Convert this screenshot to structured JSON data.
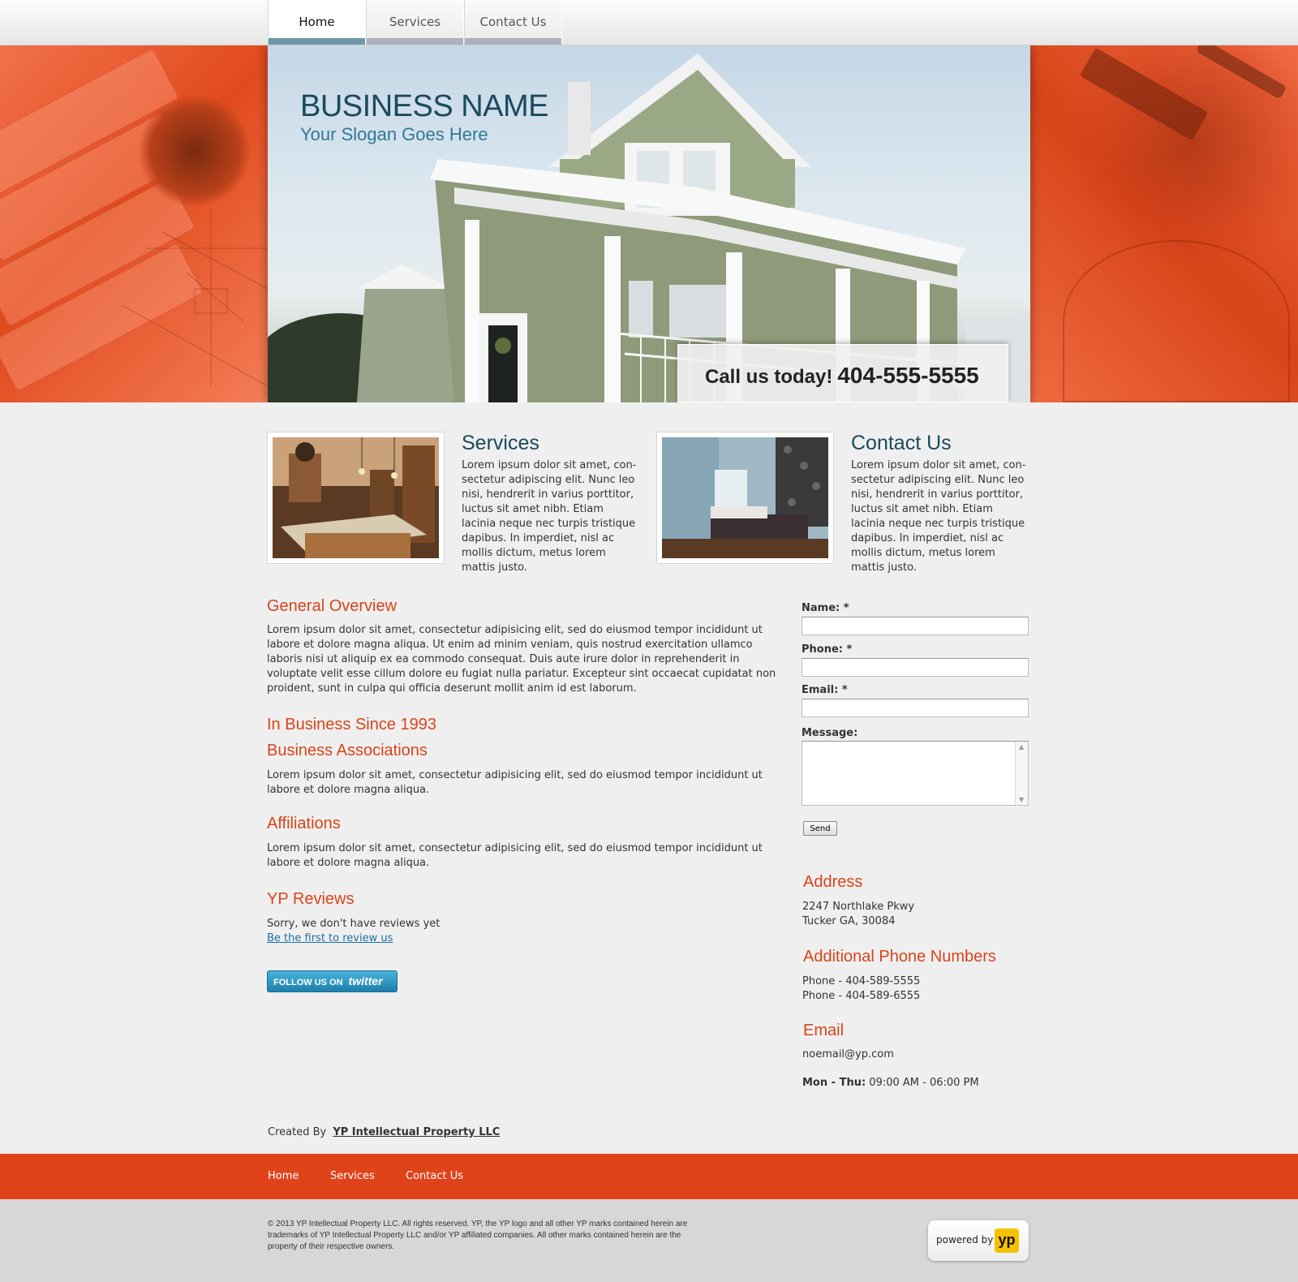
{
  "nav": {
    "items": [
      {
        "label": "Home",
        "active": true
      },
      {
        "label": "Services",
        "active": false
      },
      {
        "label": "Contact Us",
        "active": false
      }
    ]
  },
  "hero": {
    "business_name": "BUSINESS NAME",
    "slogan": "Your Slogan Goes Here",
    "call_label": "Call us today!",
    "phone": "404-555-5555"
  },
  "features": [
    {
      "title": "Services",
      "text": "Lorem ipsum dolor sit amet, con- sectetur adipiscing elit. Nunc leo nisi, hendrerit in varius porttitor, luctus sit amet nibh. Etiam lacinia neque nec turpis tristique dapibus. In imperdiet, nisl ac mollis dictum, metus lorem mattis justo."
    },
    {
      "title": "Contact Us",
      "text": "Lorem ipsum dolor sit amet, con- sectetur adipiscing elit. Nunc leo nisi, hendrerit in varius porttitor, luctus sit amet nibh. Etiam lacinia neque nec turpis tristique dapibus. In imperdiet, nisl ac mollis dictum, metus lorem mattis justo."
    }
  ],
  "main": {
    "overview_title": "General Overview",
    "overview_text": "Lorem ipsum dolor sit amet, consectetur adipisicing elit, sed do eiusmod tempor incididunt ut labore et dolore magna aliqua. Ut enim ad minim veniam, quis nostrud exercitation ullamco laboris nisi ut aliquip ex ea commodo consequat. Duis aute irure dolor in reprehenderit in voluptate velit esse cillum dolore eu fugiat nulla pariatur. Excepteur sint occaecat cupidatat non proident, sunt in culpa qui officia deserunt mollit anim id est laborum.",
    "since_title": "In Business Since 1993",
    "associations_title": "Business Associations",
    "associations_text": "Lorem ipsum dolor sit amet, consectetur adipisicing elit, sed do eiusmod tempor incididunt ut labore et dolore magna aliqua.",
    "affiliations_title": "Affiliations",
    "affiliations_text": "Lorem ipsum dolor sit amet, consectetur adipisicing elit, sed do eiusmod tempor incididunt ut labore et dolore magna aliqua.",
    "reviews_title": "YP Reviews",
    "reviews_text": "Sorry, we don't have reviews yet",
    "reviews_link": "Be the first to review us",
    "twitter_follow": "FOLLOW US ON",
    "twitter_brand": "twitter",
    "created_by_label": "Created By",
    "created_by_link": "YP Intellectual Property LLC"
  },
  "form": {
    "name_label": "Name:",
    "phone_label": "Phone:",
    "email_label": "Email:",
    "required_mark": "*",
    "message_label": "Message:",
    "send_label": "Send"
  },
  "contact": {
    "address_title": "Address",
    "address_line1": "2247 Northlake Pkwy",
    "address_line2": "Tucker GA, 30084",
    "phones_title": "Additional Phone Numbers",
    "phone1": "Phone - 404-589-5555",
    "phone2": "Phone - 404-589-6555",
    "email_title": "Email",
    "email": "noemail@yp.com",
    "hours_days": "Mon - Thu:",
    "hours_time": "09:00 AM - 06:00 PM"
  },
  "footer": {
    "links": [
      "Home",
      "Services",
      "Contact Us"
    ],
    "legal": "© 2013  YP Intellectual Property LLC. All rights reserved. YP, the YP logo and all other YP marks contained herein are trademarks of YP Intellectual Property LLC and/or YP affiliated companies. All other marks contained herein are the property of their respective owners.",
    "powered_by": "powered by",
    "powered_logo": "yp"
  },
  "colors": {
    "accent_orange": "#e0431a",
    "heading_orange": "#d9441a",
    "heading_teal": "#1a4a5c",
    "link_blue": "#1a6fa8"
  }
}
